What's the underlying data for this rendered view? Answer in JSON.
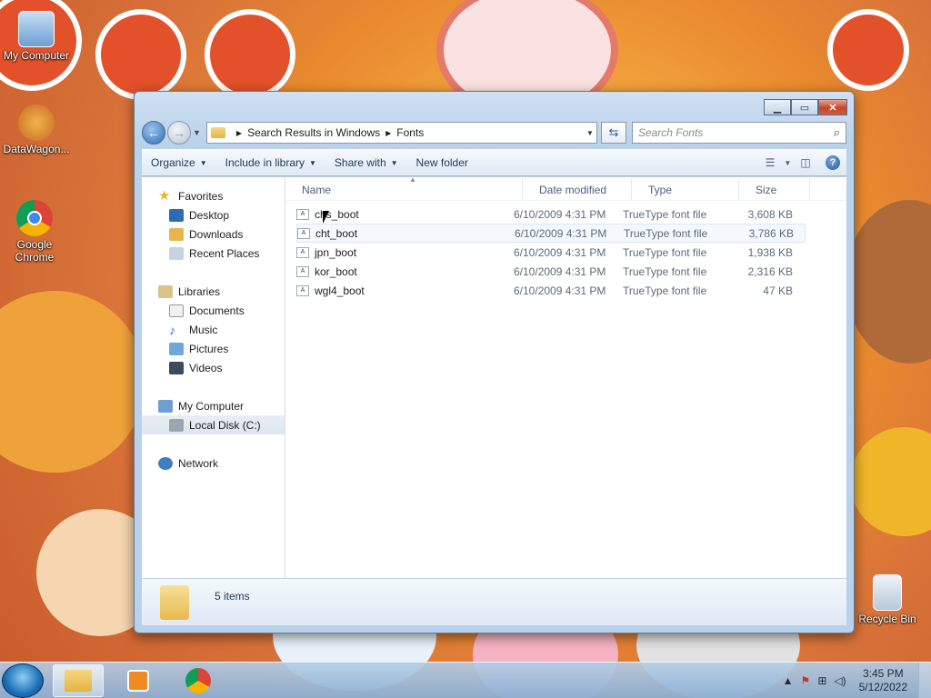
{
  "desktop": {
    "icons": [
      {
        "label": "My Computer"
      },
      {
        "label": "DataWagon..."
      },
      {
        "label": "Google Chrome"
      },
      {
        "label": "Recycle Bin"
      }
    ]
  },
  "window": {
    "address": {
      "crumbs": [
        "Search Results in Windows",
        "Fonts"
      ]
    },
    "search": {
      "placeholder": "Search Fonts"
    },
    "toolbar": {
      "organize": "Organize",
      "include": "Include in library",
      "share": "Share with",
      "new_folder": "New folder"
    },
    "nav": {
      "favorites": "Favorites",
      "desktop": "Desktop",
      "downloads": "Downloads",
      "recent": "Recent Places",
      "libraries": "Libraries",
      "documents": "Documents",
      "music": "Music",
      "pictures": "Pictures",
      "videos": "Videos",
      "computer": "My Computer",
      "local_disk": "Local Disk (C:)",
      "network": "Network"
    },
    "columns": {
      "name": "Name",
      "date": "Date modified",
      "type": "Type",
      "size": "Size"
    },
    "files": [
      {
        "name": "chs_boot",
        "date": "6/10/2009 4:31 PM",
        "type": "TrueType font file",
        "size": "3,608 KB"
      },
      {
        "name": "cht_boot",
        "date": "6/10/2009 4:31 PM",
        "type": "TrueType font file",
        "size": "3,786 KB"
      },
      {
        "name": "jpn_boot",
        "date": "6/10/2009 4:31 PM",
        "type": "TrueType font file",
        "size": "1,938 KB"
      },
      {
        "name": "kor_boot",
        "date": "6/10/2009 4:31 PM",
        "type": "TrueType font file",
        "size": "2,316 KB"
      },
      {
        "name": "wgl4_boot",
        "date": "6/10/2009 4:31 PM",
        "type": "TrueType font file",
        "size": "47 KB"
      }
    ],
    "details": {
      "count": "5 items"
    }
  },
  "taskbar": {
    "time": "3:45 PM",
    "date": "5/12/2022"
  },
  "colors": {
    "accent": "#1d59a9",
    "close": "#c5462b"
  }
}
